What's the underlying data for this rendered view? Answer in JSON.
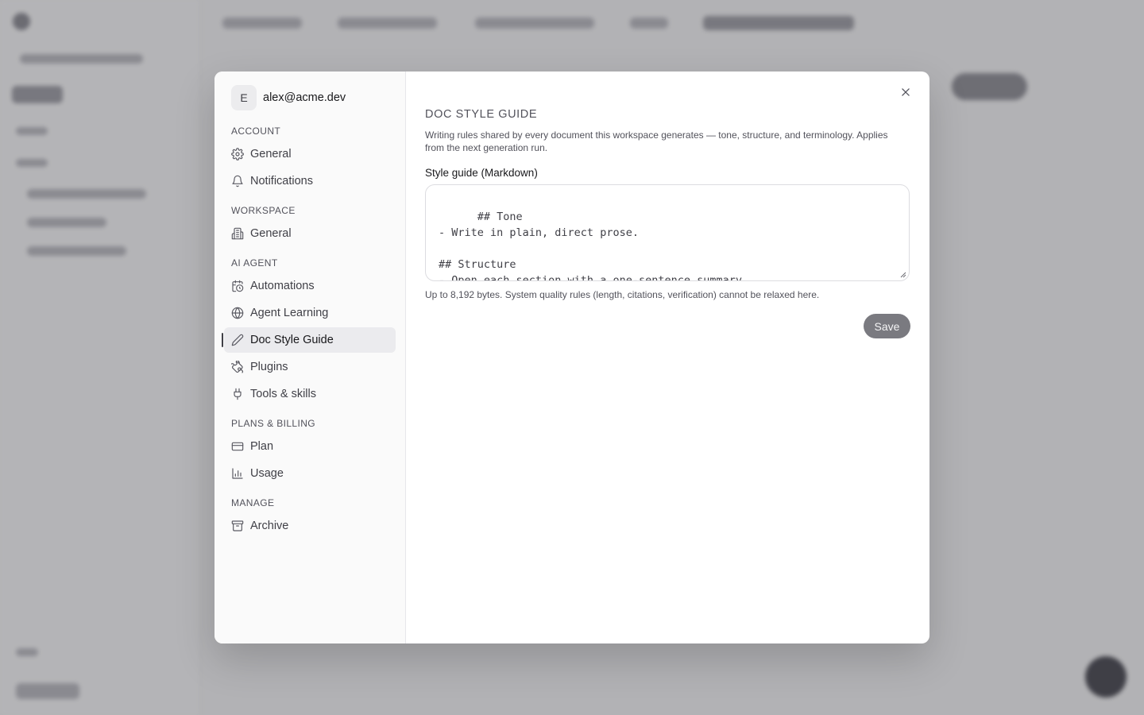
{
  "account": {
    "avatar_initial": "E",
    "email": "alex@acme.dev"
  },
  "nav": {
    "sections": [
      {
        "label": "ACCOUNT",
        "items": [
          {
            "label": "General",
            "icon": "gear-icon"
          },
          {
            "label": "Notifications",
            "icon": "bell-icon"
          }
        ]
      },
      {
        "label": "WORKSPACE",
        "items": [
          {
            "label": "General",
            "icon": "building-icon"
          }
        ]
      },
      {
        "label": "AI AGENT",
        "items": [
          {
            "label": "Automations",
            "icon": "calendar-clock-icon"
          },
          {
            "label": "Agent Learning",
            "icon": "globe-icon"
          },
          {
            "label": "Doc Style Guide",
            "icon": "pencil-icon",
            "active": true
          },
          {
            "label": "Plugins",
            "icon": "puzzle-icon"
          },
          {
            "label": "Tools & skills",
            "icon": "plug-icon"
          }
        ]
      },
      {
        "label": "PLANS & BILLING",
        "items": [
          {
            "label": "Plan",
            "icon": "credit-card-icon"
          },
          {
            "label": "Usage",
            "icon": "bar-chart-icon"
          }
        ]
      },
      {
        "label": "MANAGE",
        "items": [
          {
            "label": "Archive",
            "icon": "archive-icon"
          }
        ]
      }
    ]
  },
  "main": {
    "title": "DOC STYLE GUIDE",
    "description": "Writing rules shared by every document this workspace generates — tone, structure, and terminology. Applies from the next generation run.",
    "field_label": "Style guide (Markdown)",
    "editor_value": "## Tone\n- Write in plain, direct prose.\n\n## Structure\n- Open each section with a one-sentence summary.",
    "hint": "Up to 8,192 bytes. System quality rules (length, citations, verification) cannot be relaxed here.",
    "save_label": "Save",
    "close_icon": "close-icon"
  },
  "colors": {
    "save_button": "#7a7a80",
    "active_item": "#ebebee",
    "overlay": "rgba(40,40,48,0.32)"
  }
}
